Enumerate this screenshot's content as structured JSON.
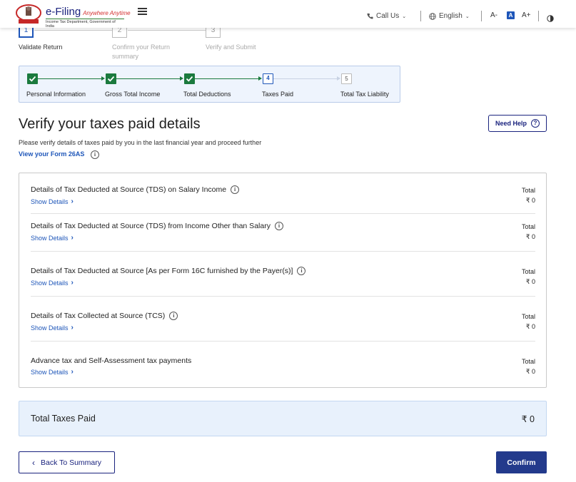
{
  "header": {
    "logo_title": "e-Filing",
    "logo_tagline": "Anywhere Anytime",
    "logo_subtitle": "Income Tax Department, Government of India",
    "call_us": "Call Us",
    "language": "English",
    "font_decrease": "A-",
    "font_default": "A",
    "font_increase": "A+"
  },
  "top_stepper": {
    "steps": [
      {
        "number": "1",
        "label": "Validate Return"
      },
      {
        "number": "2",
        "label": "Confirm your Return summary"
      },
      {
        "number": "3",
        "label": "Verify and Submit"
      }
    ]
  },
  "progress": {
    "steps": [
      {
        "label": "Personal Information",
        "status": "done"
      },
      {
        "label": "Gross Total Income",
        "status": "done"
      },
      {
        "label": "Total Deductions",
        "status": "done"
      },
      {
        "label": "Taxes Paid",
        "status": "current",
        "number": "4"
      },
      {
        "label": "Total Tax Liability",
        "status": "pending",
        "number": "5"
      }
    ]
  },
  "page": {
    "title": "Verify your taxes paid details",
    "need_help": "Need Help",
    "subtitle": "Please verify details of taxes paid by you in the last financial year and proceed further",
    "view_26as": "View your Form 26AS"
  },
  "sections": [
    {
      "title": "Details of Tax Deducted at Source (TDS) on Salary Income",
      "show_details": "Show Details",
      "total_label": "Total",
      "total_value": "₹ 0",
      "has_info": true
    },
    {
      "title": "Details of Tax Deducted at Source (TDS) from Income Other than Salary",
      "show_details": "Show Details",
      "total_label": "Total",
      "total_value": "₹ 0",
      "has_info": true
    },
    {
      "title": "Details of Tax Deducted at Source [As per Form 16C furnished by the Payer(s)]",
      "show_details": "Show Details",
      "total_label": "Total",
      "total_value": "₹ 0",
      "has_info": true
    },
    {
      "title": "Details of Tax Collected at Source (TCS)",
      "show_details": "Show Details",
      "total_label": "Total",
      "total_value": "₹ 0",
      "has_info": true
    },
    {
      "title": "Advance tax and Self-Assessment tax payments",
      "show_details": "Show Details",
      "total_label": "Total",
      "total_value": "₹ 0",
      "has_info": false
    }
  ],
  "total": {
    "label": "Total Taxes Paid",
    "value": "₹ 0"
  },
  "footer": {
    "back": "Back To Summary",
    "confirm": "Confirm"
  },
  "colors": {
    "primary": "#1a237e",
    "link": "#1e56b9",
    "success": "#1b7a3e"
  }
}
